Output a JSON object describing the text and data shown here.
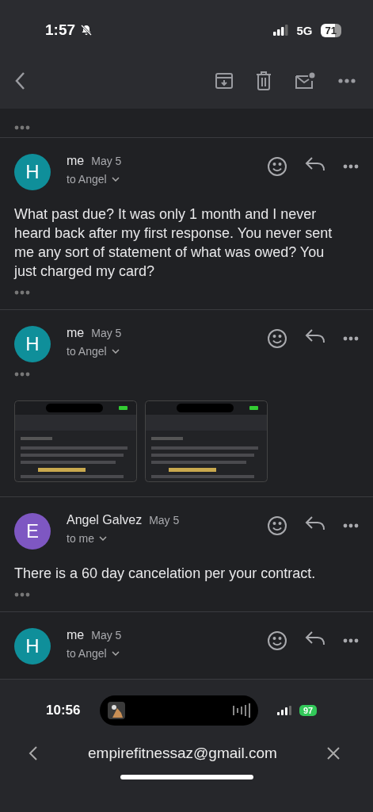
{
  "status_bar": {
    "time": "1:57",
    "muted": true,
    "network": "5G",
    "battery": "71"
  },
  "messages": [
    {
      "avatar": "H",
      "color": "#0f8f9a",
      "sender": "me",
      "date": "May 5",
      "recipient": "to Angel",
      "body": "What past due? It was only 1 month and I never heard back after my first response. You never sent me any sort of statement of what was owed? You just charged my card?"
    },
    {
      "avatar": "H",
      "color": "#0f8f9a",
      "sender": "me",
      "date": "May 5",
      "recipient": "to Angel"
    },
    {
      "avatar": "E",
      "color": "#7e57c2",
      "sender": "Angel Galvez",
      "date": "May 5",
      "recipient": "to me",
      "body": "There is a 60 day cancelation per your contract."
    },
    {
      "avatar": "H",
      "color": "#0f8f9a",
      "sender": "me",
      "date": "May 5",
      "recipient": "to Angel"
    }
  ],
  "overlay": {
    "time": "10:56",
    "battery": "97",
    "charging": true,
    "query": "empirefitnessaz@gmail.com"
  }
}
